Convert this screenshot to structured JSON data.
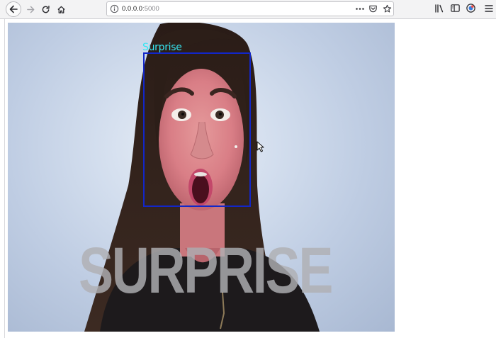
{
  "browser": {
    "url_host": "0.0.0.0",
    "url_port": ":5000",
    "icons": [
      "back-arrow-icon",
      "forward-arrow-icon",
      "reload-icon",
      "home-icon",
      "info-icon",
      "more-dots-icon",
      "pocket-icon",
      "star-icon",
      "library-icon",
      "sidebar-icon",
      "account-icon",
      "hamburger-menu-icon"
    ]
  },
  "video": {
    "detected_emotion": "Surprise",
    "caption": "SURPRISE"
  },
  "colors": {
    "face_box": "#1226c8",
    "emotion_label": "#36e6f2",
    "caption": "#b0b0b4",
    "background": "#bfcde3"
  }
}
